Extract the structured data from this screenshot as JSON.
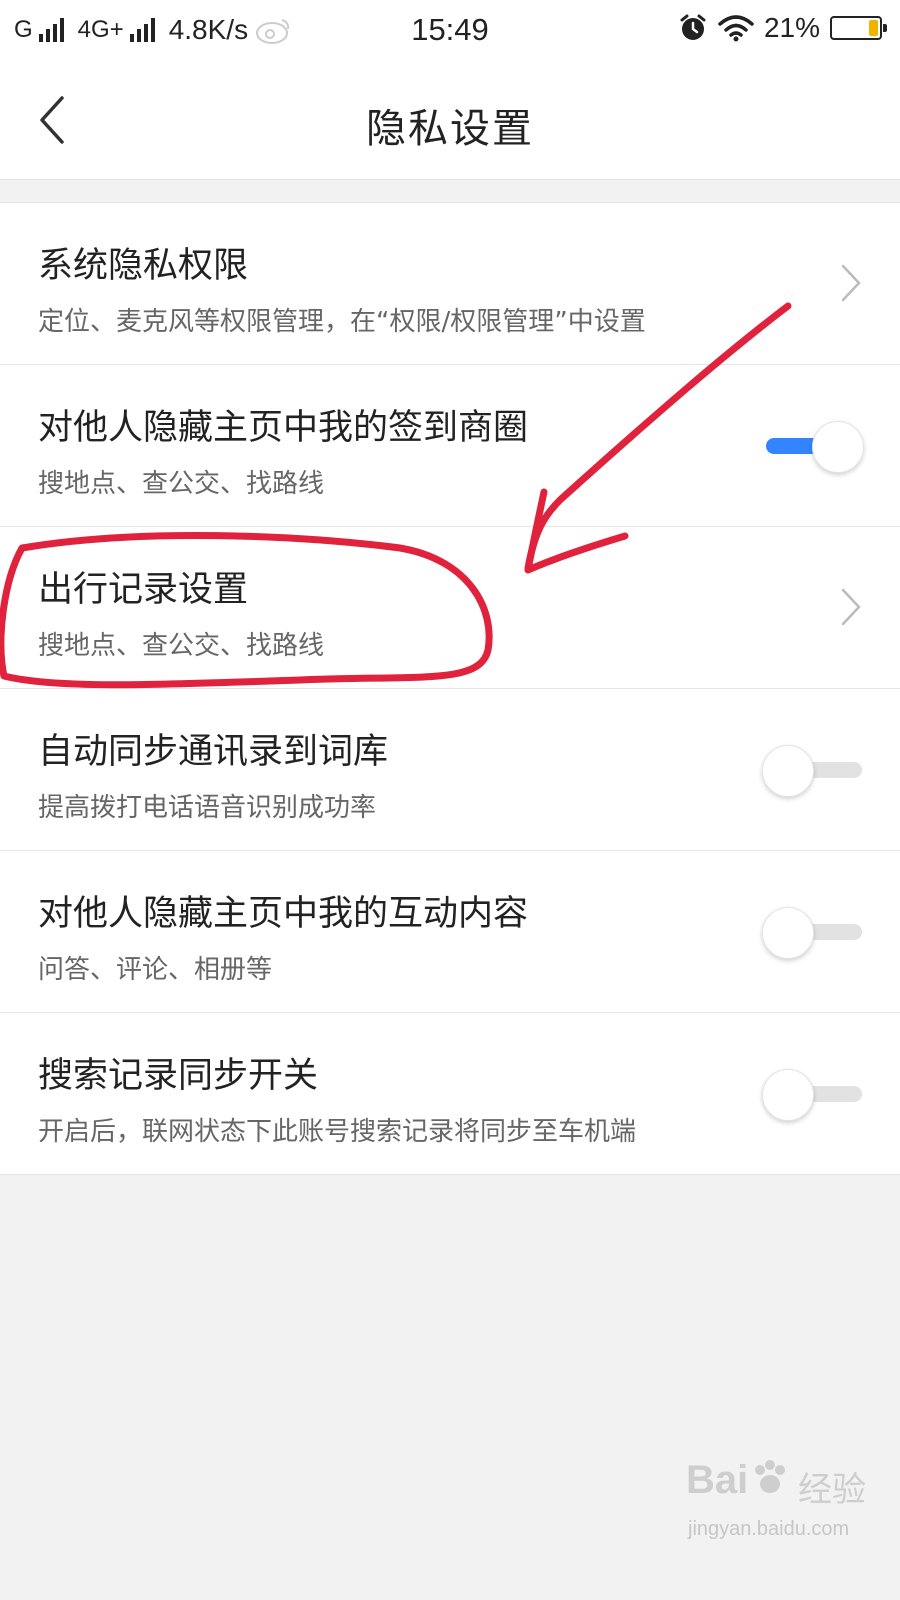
{
  "status_bar": {
    "carrier1": "G",
    "carrier2": "4G+",
    "speed": "4.8K/s",
    "time": "15:49",
    "battery": "21%",
    "battery_level": 0.21
  },
  "header": {
    "title": "隐私设置"
  },
  "settings": [
    {
      "title": "系统隐私权限",
      "subtitle": "定位、麦克风等权限管理，在“权限/权限管理”中设置",
      "control": "chevron"
    },
    {
      "title": "对他人隐藏主页中我的签到商圈",
      "subtitle": "搜地点、查公交、找路线",
      "control": "toggle",
      "on": true
    },
    {
      "title": "出行记录设置",
      "subtitle": "搜地点、查公交、找路线",
      "control": "chevron"
    },
    {
      "title": "自动同步通讯录到词库",
      "subtitle": "提高拨打电话语音识别成功率",
      "control": "toggle",
      "on": false
    },
    {
      "title": "对他人隐藏主页中我的互动内容",
      "subtitle": "问答、评论、相册等",
      "control": "toggle",
      "on": false
    },
    {
      "title": "搜索记录同步开关",
      "subtitle": "开启后，联网状态下此账号搜索记录将同步至车机端",
      "control": "toggle",
      "on": false
    }
  ],
  "colors": {
    "toggle_on": "#3385ff",
    "annotation": "#e0223c",
    "background": "#f2f2f2"
  },
  "watermark": {
    "brand": "Bai",
    "brand_cn": "经验",
    "url": "jingyan.baidu.com"
  }
}
